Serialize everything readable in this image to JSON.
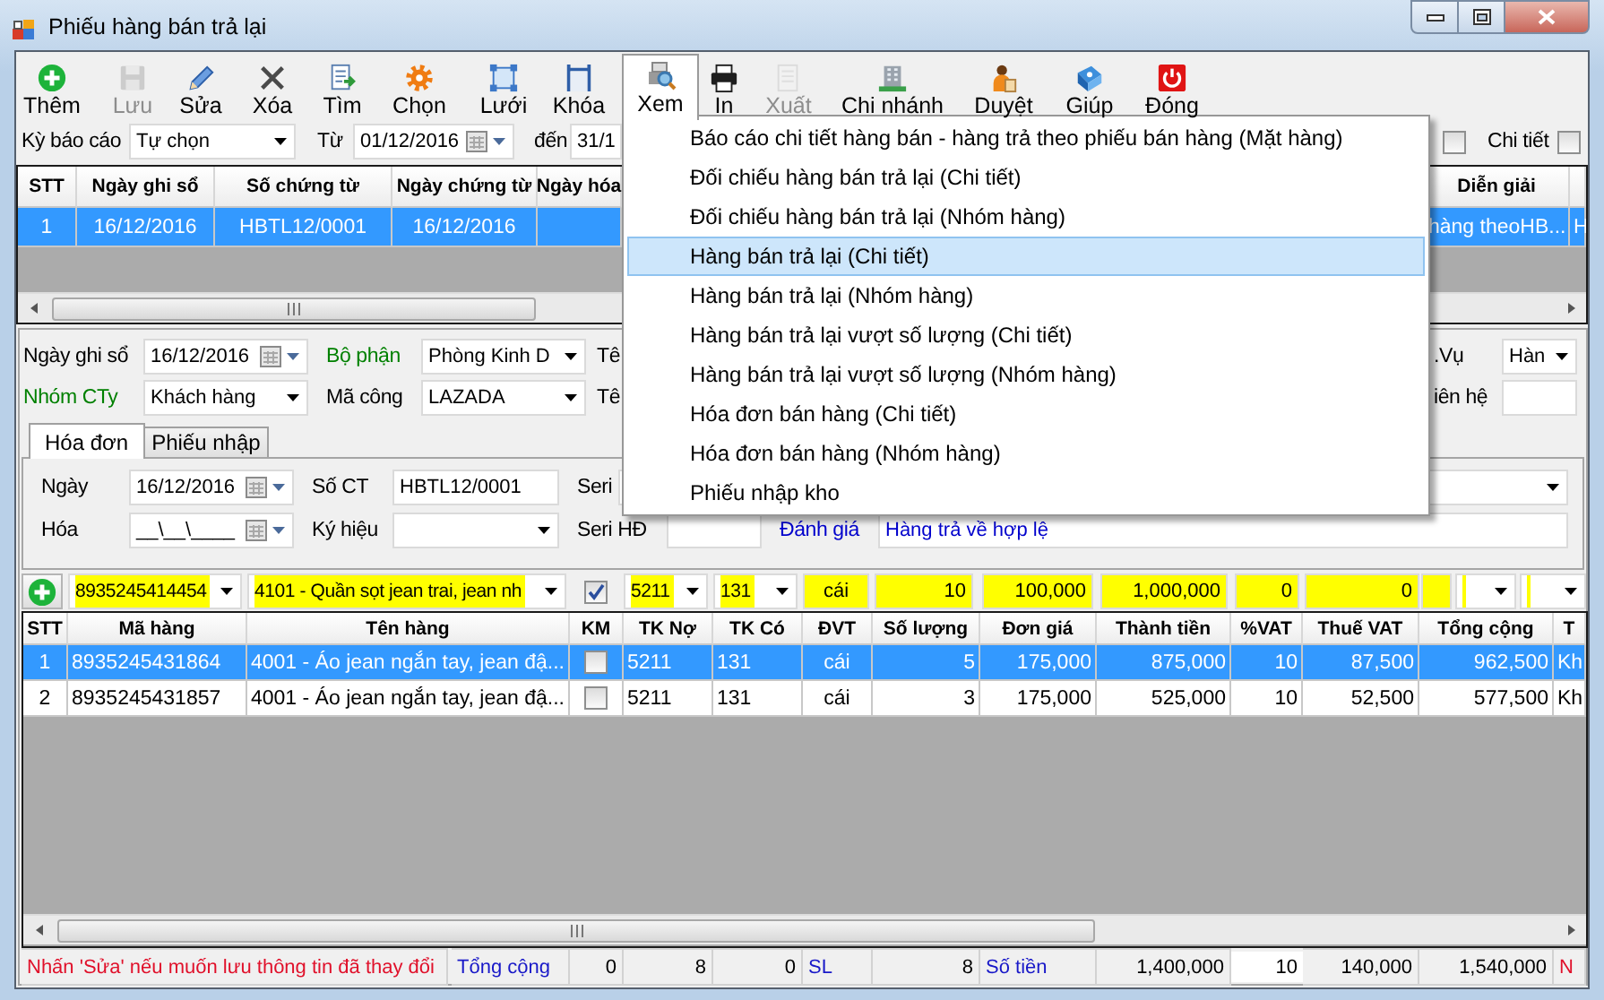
{
  "window": {
    "title": "Phiếu hàng bán trả lại"
  },
  "toolbar": [
    {
      "label": "Thêm",
      "kind": "add",
      "disabled": false,
      "selected": false
    },
    {
      "label": "Lưu",
      "kind": "save",
      "disabled": true,
      "selected": false
    },
    {
      "label": "Sửa",
      "kind": "edit",
      "disabled": false,
      "selected": false
    },
    {
      "label": "Xóa",
      "kind": "delete",
      "disabled": false,
      "selected": false
    },
    {
      "label": "Tìm",
      "kind": "find",
      "disabled": false,
      "selected": false
    },
    {
      "label": "Chọn",
      "kind": "choose",
      "disabled": false,
      "selected": false
    },
    {
      "label": "Lưới",
      "kind": "grid",
      "disabled": false,
      "selected": false
    },
    {
      "label": "Khóa",
      "kind": "lock",
      "disabled": false,
      "selected": false
    },
    {
      "label": "Xem",
      "kind": "view",
      "disabled": false,
      "selected": true
    },
    {
      "label": "In",
      "kind": "print",
      "disabled": false,
      "selected": false
    },
    {
      "label": "Xuất",
      "kind": "export",
      "disabled": true,
      "selected": false
    },
    {
      "label": "Chi nhánh",
      "kind": "branch",
      "disabled": false,
      "selected": false
    },
    {
      "label": "Duyệt",
      "kind": "approve",
      "disabled": false,
      "selected": false
    },
    {
      "label": "Giúp",
      "kind": "help",
      "disabled": false,
      "selected": false
    },
    {
      "label": "Đóng",
      "kind": "close",
      "disabled": false,
      "selected": false
    }
  ],
  "filter": {
    "items": [
      {
        "kind": "label",
        "text": "Kỳ báo cáo"
      },
      {
        "kind": "combo",
        "value": "Tự chọn"
      },
      {
        "kind": "label",
        "text": "Từ"
      },
      {
        "kind": "date",
        "value": "01/12/2016"
      },
      {
        "kind": "label",
        "text": "đến"
      },
      {
        "kind": "field",
        "value": "31/1"
      },
      {
        "kind": "checkbox",
        "checked": false
      },
      {
        "kind": "label",
        "text": "Chi tiết"
      },
      {
        "kind": "checkbox",
        "checked": false
      }
    ]
  },
  "voucher_list": {
    "columns": [
      "STT",
      "Ngày ghi sổ",
      "Số chứng từ",
      "Ngày chứng từ",
      "Ngày hóa",
      "Diễn giải"
    ],
    "rows": [
      {
        "selected": true,
        "cells": [
          "1",
          "16/12/2016",
          "HBTL12/0001",
          "16/12/2016",
          null,
          "hàng theoHB...",
          "H"
        ]
      }
    ]
  },
  "form": {
    "rows": [
      [
        {
          "kind": "label",
          "text": "Ngày ghi sổ"
        },
        {
          "kind": "date",
          "value": "16/12/2016"
        },
        {
          "kind": "label",
          "text": "Bộ phận",
          "color": "#008000"
        },
        {
          "kind": "combo",
          "value": "Phòng Kinh D"
        },
        {
          "kind": "label",
          "text": "Tê"
        },
        {
          "kind": "label",
          "text": ".Vụ"
        },
        {
          "kind": "combo",
          "value": "Hàn"
        }
      ],
      [
        {
          "kind": "label",
          "text": "Nhóm CTy",
          "color": "#008000"
        },
        {
          "kind": "combo",
          "value": "Khách hàng"
        },
        {
          "kind": "label",
          "text": "Mã công"
        },
        {
          "kind": "combo",
          "value": "LAZADA"
        },
        {
          "kind": "label",
          "text": "Tê"
        },
        {
          "kind": "label",
          "text": "iên hệ"
        },
        {
          "kind": "field"
        }
      ]
    ]
  },
  "tabs": [
    {
      "label": "Hóa đơn",
      "selected": true
    },
    {
      "label": "Phiếu nhập",
      "selected": false
    }
  ],
  "invoice": {
    "rows": [
      [
        {
          "kind": "label",
          "text": "Ngày"
        },
        {
          "kind": "date",
          "value": "16/12/2016"
        },
        {
          "kind": "label",
          "text": "Số CT"
        },
        {
          "kind": "field",
          "value": "HBTL12/0001"
        },
        {
          "kind": "label",
          "text": "Seri"
        },
        {
          "kind": "combo"
        }
      ],
      [
        {
          "kind": "label",
          "text": "Hóa"
        },
        {
          "kind": "date",
          "value": "__\\__\\____"
        },
        {
          "kind": "label",
          "text": "Ký hiệu"
        },
        {
          "kind": "combo"
        },
        {
          "kind": "label",
          "text": "Seri HĐ"
        },
        {
          "kind": "field"
        },
        {
          "kind": "label",
          "text": "Đánh giá",
          "color": "#0000cc"
        },
        {
          "kind": "field",
          "value": "Hàng trả về hợp lệ",
          "color": "#0000cc"
        }
      ]
    ]
  },
  "entry_row": {
    "items": [
      {
        "kind": "add_button"
      },
      {
        "kind": "combo",
        "value": "8935245414454",
        "highlighted": true
      },
      {
        "kind": "combo",
        "value": "4101 - Quần sọt jean trai, jean nh",
        "highlighted": true
      },
      {
        "kind": "checkbox",
        "checked": true
      },
      {
        "kind": "combo",
        "value": "5211",
        "highlighted": true
      },
      {
        "kind": "combo",
        "value": "131",
        "highlighted": true
      },
      {
        "kind": "field",
        "value": "cái",
        "highlighted": true
      },
      {
        "kind": "number",
        "value": "10",
        "highlighted": true
      },
      {
        "kind": "number",
        "value": "100,000",
        "highlighted": true
      },
      {
        "kind": "number",
        "value": "1,000,000",
        "highlighted": true
      },
      {
        "kind": "number",
        "value": "0",
        "highlighted": true
      },
      {
        "kind": "number",
        "value": "0",
        "highlighted": true
      },
      {
        "kind": "field",
        "highlighted": true
      },
      {
        "kind": "combo",
        "highlighted": true
      },
      {
        "kind": "combo",
        "highlighted": true
      }
    ]
  },
  "details": {
    "columns": [
      "STT",
      "Mã hàng",
      "Tên hàng",
      "KM",
      "TK Nợ",
      "TK Có",
      "ĐVT",
      "Số lượng",
      "Đơn giá",
      "Thành tiền",
      "%VAT",
      "Thuế VAT",
      "Tổng cộng",
      "T"
    ],
    "rows": [
      {
        "selected": true,
        "checked": false,
        "cells": [
          "1",
          "8935245431864",
          "4001 - Áo jean ngắn tay, jean đậ...",
          null,
          "5211",
          "131",
          "cái",
          "5",
          "175,000",
          "875,000",
          "10",
          "87,500",
          "962,500",
          "Kh"
        ]
      },
      {
        "selected": false,
        "checked": false,
        "cells": [
          "2",
          "8935245431857",
          "4001 - Áo jean ngắn tay, jean đậ...",
          null,
          "5211",
          "131",
          "cái",
          "3",
          "175,000",
          "525,000",
          "10",
          "52,500",
          "577,500",
          "Kh"
        ]
      }
    ]
  },
  "footer": [
    {
      "kind": "note",
      "text": "Nhấn 'Sửa' nếu muốn lưu thông tin đã thay đổi"
    },
    {
      "kind": "label",
      "text": "Tổng cộng"
    },
    {
      "kind": "value",
      "text": "0"
    },
    {
      "kind": "value",
      "text": "8"
    },
    {
      "kind": "value",
      "text": "0"
    },
    {
      "kind": "label",
      "text": "SL"
    },
    {
      "kind": "value",
      "text": "8"
    },
    {
      "kind": "label",
      "text": "Số tiền"
    },
    {
      "kind": "value",
      "text": "1,400,000"
    },
    {
      "kind": "input",
      "text": "10"
    },
    {
      "kind": "value",
      "text": "140,000"
    },
    {
      "kind": "value",
      "text": "1,540,000"
    },
    {
      "kind": "note",
      "text": "N"
    }
  ],
  "view_menu": {
    "items": [
      {
        "label": "Báo cáo chi tiết hàng bán - hàng trả theo phiếu bán hàng (Mặt hàng)",
        "selected": false
      },
      {
        "label": "Đối chiếu hàng bán trả lại (Chi tiết)",
        "selected": false
      },
      {
        "label": "Đối chiếu hàng bán trả lại (Nhóm hàng)",
        "selected": false
      },
      {
        "label": "Hàng bán trả lại (Chi tiết)",
        "selected": true
      },
      {
        "label": "Hàng bán trả lại (Nhóm hàng)",
        "selected": false
      },
      {
        "label": "Hàng bán trả lại vượt số lượng (Chi tiết)",
        "selected": false
      },
      {
        "label": "Hàng bán trả lại vượt số lượng (Nhóm hàng)",
        "selected": false
      },
      {
        "label": "Hóa đơn bán hàng (Chi tiết)",
        "selected": false
      },
      {
        "label": "Hóa đơn bán hàng (Nhóm hàng)",
        "selected": false
      },
      {
        "label": "Phiếu nhập kho",
        "selected": false
      }
    ]
  }
}
